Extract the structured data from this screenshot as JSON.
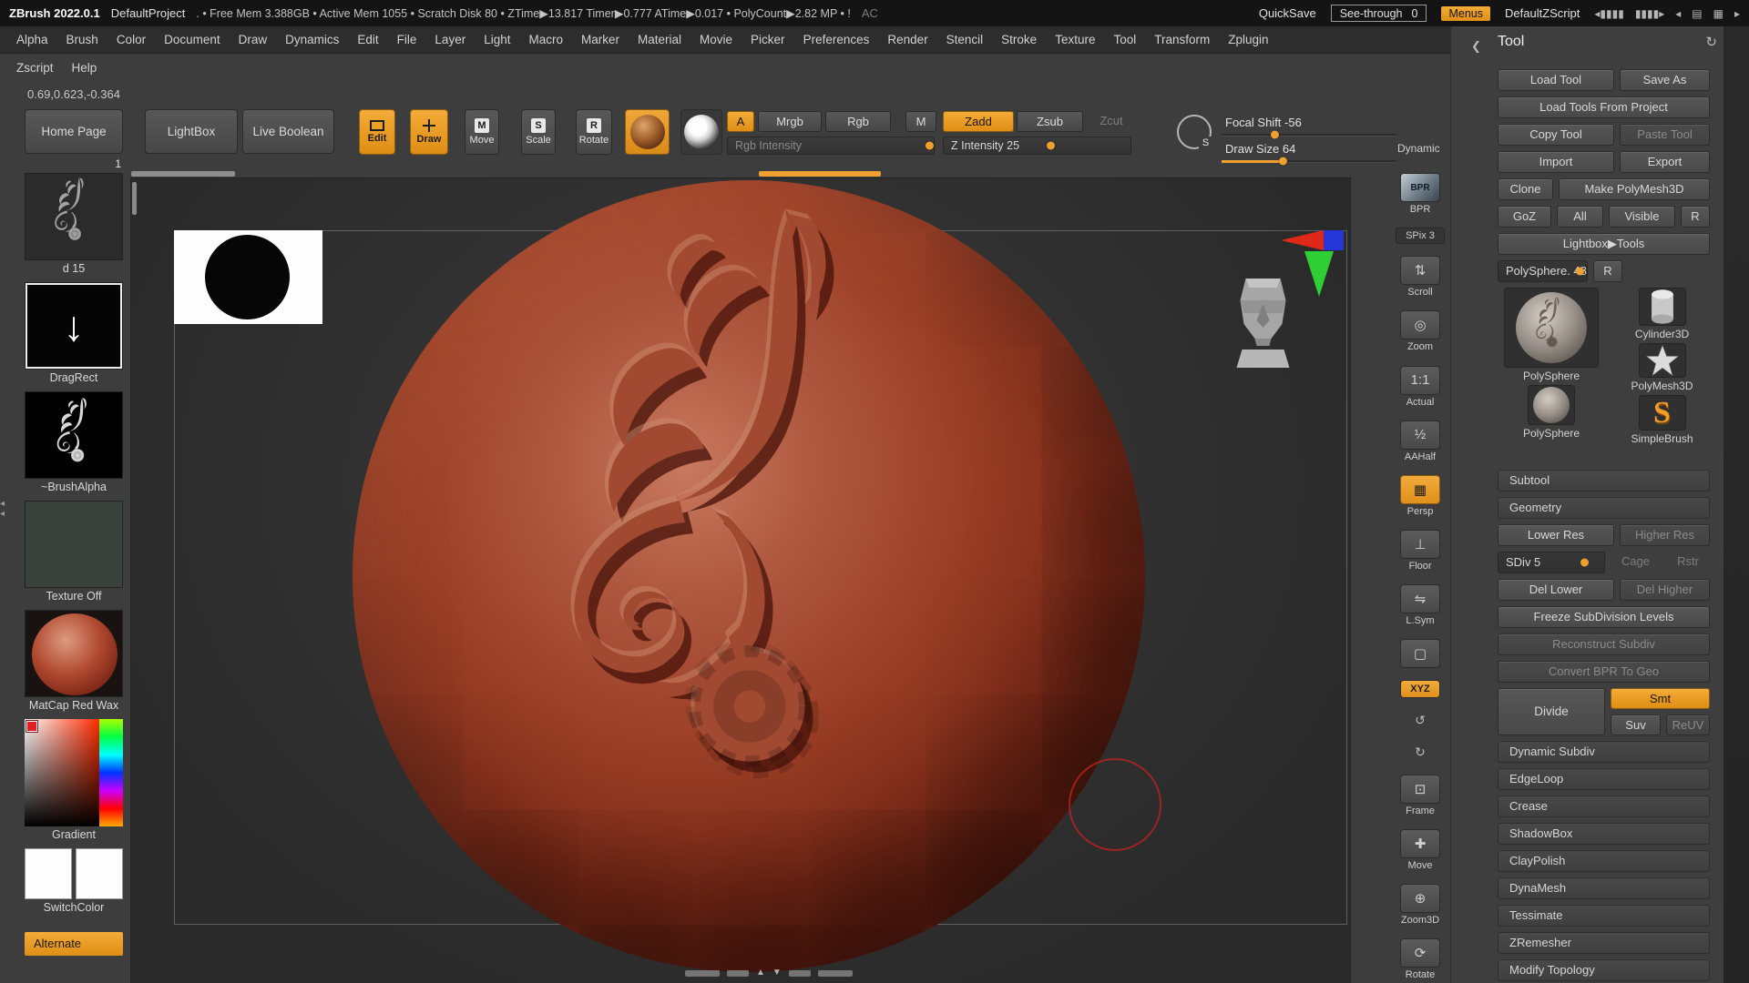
{
  "titlebar": {
    "app_name": "ZBrush 2022.0.1",
    "project_name": "DefaultProject",
    "stats": ". • Free Mem 3.388GB • Active Mem 1055 • Scratch Disk 80 • ZTime▶13.817 Timer▶0.777 ATime▶0.017 • PolyCount▶2.82 MP • !",
    "ac_label": "AC",
    "quicksave_label": "QuickSave",
    "seethrough_label": "See-through",
    "seethrough_value": "0",
    "menus_label": "Menus",
    "zscript_label": "DefaultZScript",
    "window_icons": [
      "◂▮▮▮▮",
      "▮▮▮▮▸",
      "◂",
      "▤",
      "▦",
      "▸"
    ]
  },
  "menubar": {
    "row1": [
      "Alpha",
      "Brush",
      "Color",
      "Document",
      "Draw",
      "Dynamics",
      "Edit",
      "File",
      "Layer",
      "Light",
      "Macro",
      "Marker",
      "Material",
      "Movie",
      "Picker",
      "Preferences",
      "Render",
      "Stencil",
      "Stroke",
      "Texture",
      "Tool",
      "Transform",
      "Zplugin"
    ],
    "row2": [
      "Zscript",
      "Help"
    ]
  },
  "coords_readout": "0.69,0.623,-0.364",
  "shelf": {
    "home_page": "Home Page",
    "lightbox": "LightBox",
    "live_boolean": "Live Boolean",
    "edit": "Edit",
    "draw": "Draw",
    "move": "Move",
    "move_badge": "M",
    "scale": "Scale",
    "scale_badge": "S",
    "rotate": "Rotate",
    "rotate_badge": "R",
    "a_label": "A",
    "mrgb": "Mrgb",
    "rgb": "Rgb",
    "m_label": "M",
    "zadd": "Zadd",
    "zsub": "Zsub",
    "zcut": "Zcut",
    "rgb_intensity": "Rgb Intensity",
    "z_intensity": "Z Intensity 25",
    "focal_shift": "Focal Shift -56",
    "draw_size": "Draw Size 64",
    "dynamic_label": "Dynamic",
    "s_badge": "S"
  },
  "left_palette": {
    "brush_label": "d 15",
    "brush_badge": "1",
    "stroke_label": "DragRect",
    "stroke_glyph": "↓",
    "alpha_label": "~BrushAlpha",
    "texture_label": "Texture Off",
    "material_label": "MatCap Red Wax",
    "picker_label": "Gradient",
    "switch_label": "SwitchColor",
    "alternate_label": "Alternate"
  },
  "right_strip": [
    {
      "name": "bpr",
      "glyph": "BPR",
      "label": "BPR"
    },
    {
      "name": "spix",
      "glyph": "",
      "label": "SPix 3",
      "slider": true
    },
    {
      "name": "scroll",
      "glyph": "⇅",
      "label": "Scroll"
    },
    {
      "name": "zoom",
      "glyph": "◎",
      "label": "Zoom"
    },
    {
      "name": "actual",
      "glyph": "1:1",
      "label": "Actual"
    },
    {
      "name": "aahalf",
      "glyph": "½",
      "label": "AAHalf"
    },
    {
      "name": "persp",
      "glyph": "▦",
      "label": "Persp",
      "active": true
    },
    {
      "name": "floor",
      "glyph": "⊥",
      "label": "Floor"
    },
    {
      "name": "lsym",
      "glyph": "⇋",
      "label": "L.Sym"
    },
    {
      "name": "transp",
      "glyph": "▢",
      "label": ""
    },
    {
      "name": "xyz",
      "glyph": "XYZ",
      "label": "",
      "orange": true
    },
    {
      "name": "rot-ccw",
      "glyph": "↺",
      "label": "",
      "small": true
    },
    {
      "name": "rot-cw",
      "glyph": "↻",
      "label": "",
      "small": true
    },
    {
      "name": "frame",
      "glyph": "⊡",
      "label": "Frame"
    },
    {
      "name": "move3d",
      "glyph": "✚",
      "label": "Move"
    },
    {
      "name": "zoom3d",
      "glyph": "⊕",
      "label": "Zoom3D"
    },
    {
      "name": "rotate3d",
      "glyph": "⟳",
      "label": "Rotate"
    }
  ],
  "tool_panel": {
    "title": "Tool",
    "collapse_icon": "❮",
    "refresh_icon": "↻",
    "load_tool": "Load Tool",
    "save_as": "Save As",
    "load_tools_from_project": "Load Tools From Project",
    "copy_tool": "Copy Tool",
    "paste_tool": "Paste Tool",
    "import_label": "Import",
    "export_label": "Export",
    "clone_label": "Clone",
    "make_polymesh3d": "Make PolyMesh3D",
    "goz": "GoZ",
    "all_label": "All",
    "visible_label": "Visible",
    "r_label": "R",
    "lightbox_tools": "Lightbox▶Tools",
    "active_tool_slider": "PolySphere. 48",
    "slider_r": "R",
    "tools": [
      {
        "label": "PolySphere"
      },
      {
        "label": "Cylinder3D"
      },
      {
        "label": "PolyMesh3D"
      },
      {
        "label": "PolySphere"
      },
      {
        "label": "SimpleBrush"
      }
    ],
    "subtool_header": "Subtool",
    "geometry_header": "Geometry",
    "geometry": {
      "lower_res": "Lower Res",
      "higher_res": "Higher Res",
      "sdiv": "SDiv 5",
      "cage": "Cage",
      "rstr": "Rstr",
      "del_lower": "Del Lower",
      "del_higher": "Del Higher",
      "freeze": "Freeze SubDivision Levels",
      "reconstruct": "Reconstruct Subdiv",
      "convert_bpr": "Convert BPR To Geo",
      "divide": "Divide",
      "smt": "Smt",
      "suv": "Suv",
      "reuv": "ReUV"
    },
    "subsections": [
      "Dynamic Subdiv",
      "EdgeLoop",
      "Crease",
      "ShadowBox",
      "ClayPolish",
      "DynaMesh",
      "Tessimate",
      "ZRemesher",
      "Modify Topology"
    ]
  },
  "colors": {
    "accent_orange": "#f0a030",
    "sphere_red": "#9c4027",
    "canvas_bg": "#2e2e2e"
  }
}
